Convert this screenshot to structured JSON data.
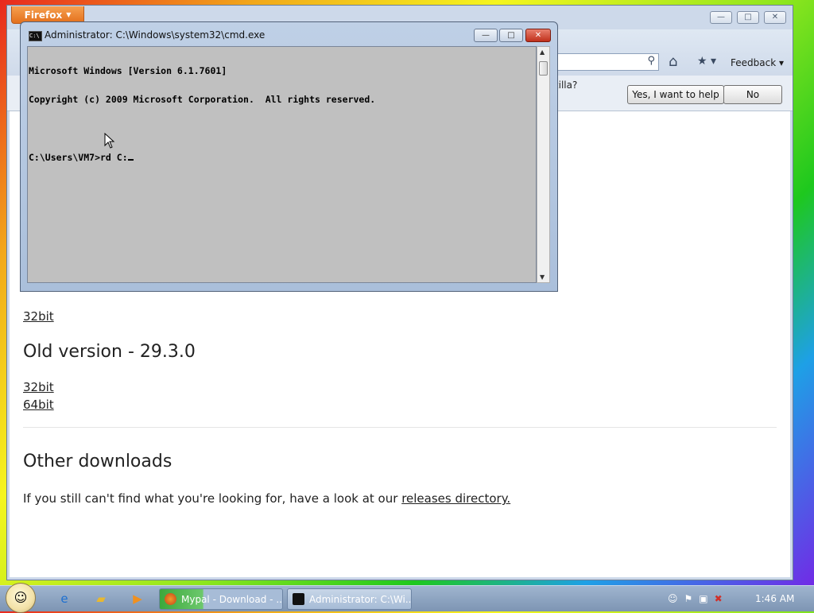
{
  "firefox": {
    "menu_label": "Firefox",
    "caption_min": "—",
    "caption_max": "□",
    "caption_close": "✕",
    "feedback_label": "Feedback",
    "notification": {
      "text": "ozilla?",
      "yes_button": "Yes, I want to help",
      "no_button": "No"
    },
    "content": {
      "link_32bit_top": "32bit",
      "old_version_heading": "Old version - 29.3.0",
      "old_32bit": "32bit",
      "old_64bit": "64bit",
      "other_heading": "Other downloads",
      "other_text": "If you still can't find what you're looking for, have a look at our",
      "releases_link": "releases directory."
    }
  },
  "cmd": {
    "title": "Administrator: C:\\Windows\\system32\\cmd.exe",
    "icon_text": "C:\\",
    "lines": [
      "Microsoft Windows [Version 6.1.7601]",
      "Copyright (c) 2009 Microsoft Corporation.  All rights reserved.",
      "",
      "C:\\Users\\VM7>rd C:"
    ]
  },
  "taskbar": {
    "tasks": [
      {
        "label": "Mypal - Download - ..."
      },
      {
        "label": "Administrator: C:\\Wi..."
      }
    ],
    "clock": "1:46 AM"
  },
  "icons": {
    "start": "windows-orb-icon",
    "ie": "internet-explorer-icon",
    "explorer": "folder-icon",
    "media": "media-player-icon",
    "search": "magnifier-icon",
    "home": "home-icon",
    "bookmark": "bookmark-star-icon"
  }
}
